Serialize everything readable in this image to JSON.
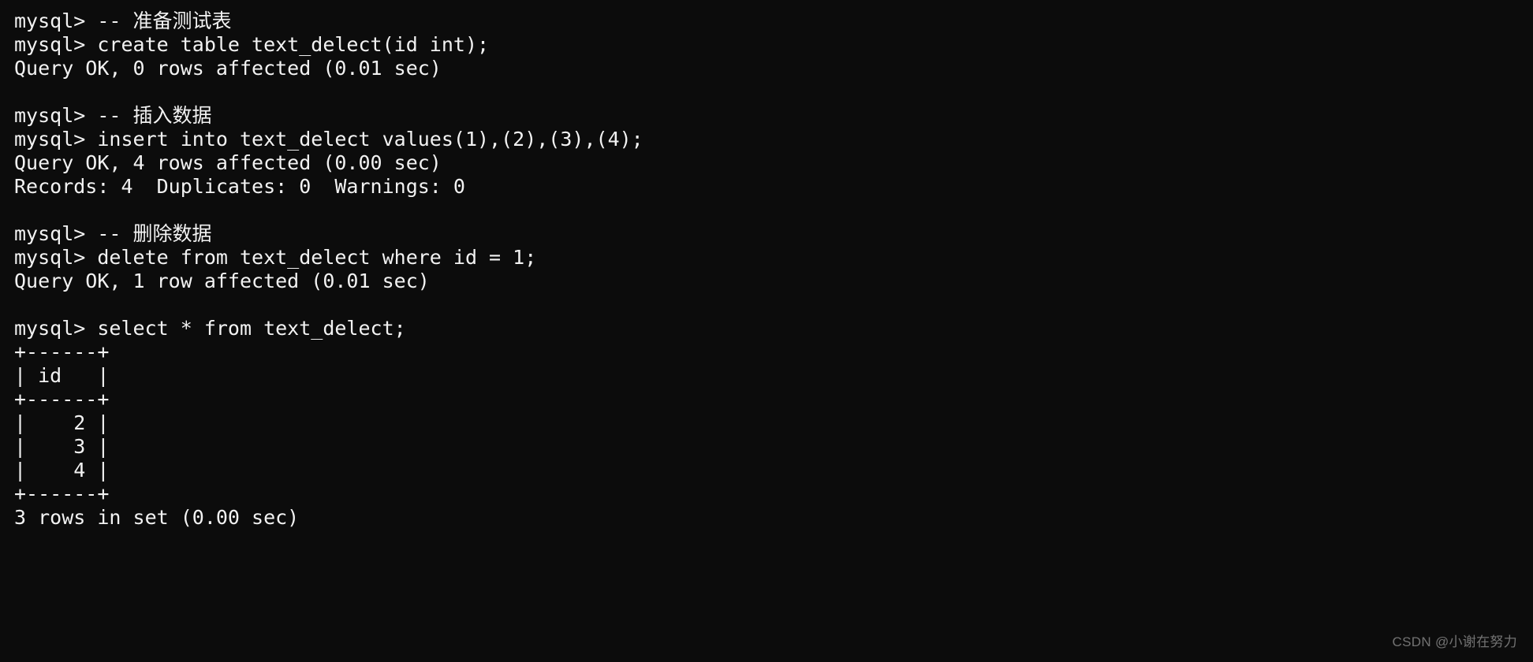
{
  "terminal": {
    "lines": [
      "mysql> -- 准备测试表",
      "mysql> create table text_delect(id int);",
      "Query OK, 0 rows affected (0.01 sec)",
      "",
      "mysql> -- 插入数据",
      "mysql> insert into text_delect values(1),(2),(3),(4);",
      "Query OK, 4 rows affected (0.00 sec)",
      "Records: 4  Duplicates: 0  Warnings: 0",
      "",
      "mysql> -- 删除数据",
      "mysql> delete from text_delect where id = 1;",
      "Query OK, 1 row affected (0.01 sec)",
      "",
      "mysql> select * from text_delect;",
      "+------+",
      "| id   |",
      "+------+",
      "|    2 |",
      "|    3 |",
      "|    4 |",
      "+------+",
      "3 rows in set (0.00 sec)"
    ]
  },
  "watermark": "CSDN @小谢在努力"
}
